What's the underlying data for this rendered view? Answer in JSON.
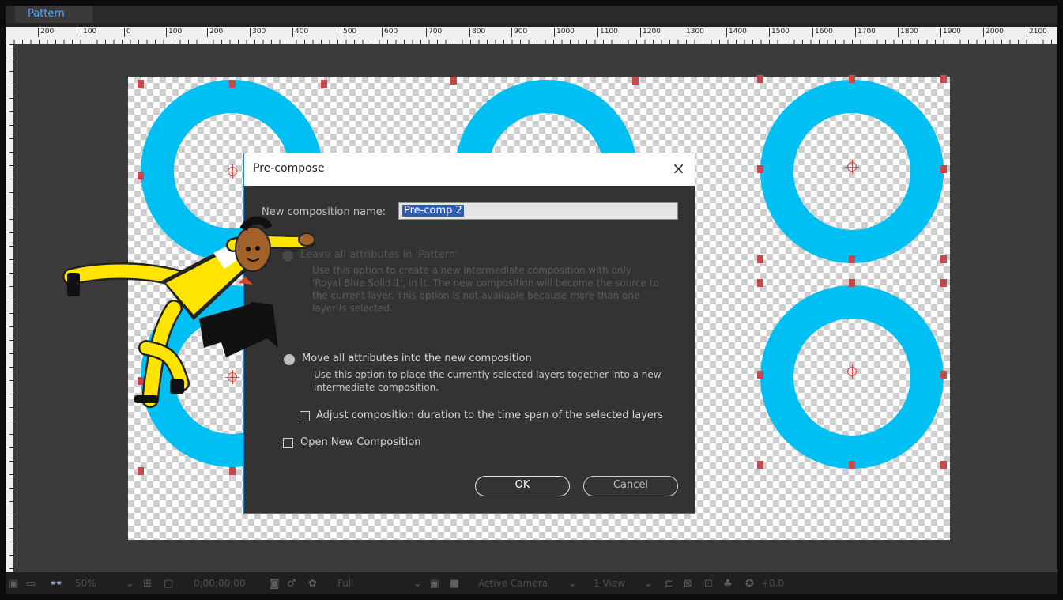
{
  "tab": {
    "label": "Pattern"
  },
  "ruler": {
    "labels": [
      "200",
      "100",
      "0",
      "100",
      "200",
      "300",
      "400",
      "500",
      "600",
      "700",
      "800",
      "900",
      "1000",
      "1100",
      "1200",
      "1300",
      "1400",
      "1500",
      "1600",
      "1700",
      "1800",
      "1900",
      "2000",
      "2100"
    ]
  },
  "dialog": {
    "title": "Pre-compose",
    "close_glyph": "×",
    "name_label": "New composition name:",
    "name_value": "Pre-comp 2",
    "option1_label": "Leave all attributes in 'Pattern'",
    "option1_desc": [
      "Use this option to create a new intermediate composition with only",
      "'Royal Blue Solid 1', in it. The new composition will become the source to",
      "the current layer. This option is not available because more than one",
      "layer is selected."
    ],
    "option2_label": "Move all attributes into the new composition",
    "option2_desc": [
      "Use this option to place the currently selected layers together into a new",
      "intermediate composition."
    ],
    "adjust_label": "Adjust composition duration to the time span of the selected layers",
    "open_new_label": "Open New Composition",
    "ok_label": "OK",
    "cancel_label": "Cancel"
  },
  "statusbar": {
    "zoom": "50%",
    "timecode": "0;00;00;00",
    "resolution": "Full",
    "camera": "Active Camera",
    "view": "1 View",
    "exposure": "+0.0"
  },
  "colors": {
    "ring": "#00bff3",
    "handle": "#c9474a",
    "dialog_border": "#1b84c8",
    "accent": "#5aa7ff"
  },
  "icons": [
    "close-icon",
    "radio-icon",
    "checkbox-icon",
    "camera-icon",
    "mask-icon",
    "color-channel-icon",
    "grid-icon",
    "region-icon",
    "chevron-down-icon",
    "reset-exposure-icon",
    "pointer-arrow-icon"
  ]
}
